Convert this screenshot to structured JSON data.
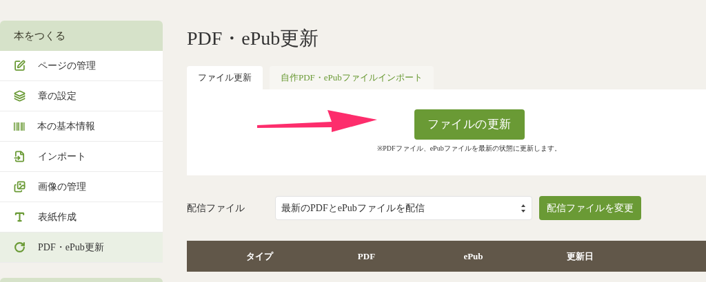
{
  "sidebar": {
    "title": "本をつくる",
    "items": [
      {
        "label": "ページの管理",
        "selected": false
      },
      {
        "label": "章の設定",
        "selected": false
      },
      {
        "label": "本の基本情報",
        "selected": false
      },
      {
        "label": "インポート",
        "selected": false
      },
      {
        "label": "画像の管理",
        "selected": false
      },
      {
        "label": "表紙作成",
        "selected": false
      },
      {
        "label": "PDF・ePub更新",
        "selected": true
      }
    ]
  },
  "page_title": "PDF・ePub更新",
  "tabs": [
    {
      "label": "ファイル更新",
      "selected": true
    },
    {
      "label": "自作PDF・ePubファイルインポート",
      "selected": false
    }
  ],
  "update_button": "ファイルの更新",
  "update_note": "※PDFファイル、ePubファイルを最新の状態に更新します。",
  "distribution": {
    "label": "配信ファイル",
    "value": "最新のPDFとePubファイルを配信",
    "button": "配信ファイルを変更"
  },
  "table": {
    "columns": [
      "タイプ",
      "PDF",
      "ePub",
      "更新日"
    ]
  }
}
